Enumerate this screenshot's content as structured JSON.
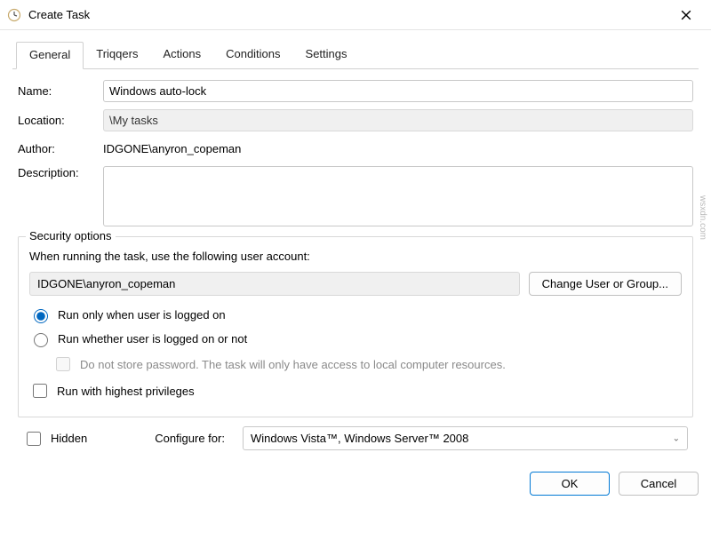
{
  "titlebar": {
    "title": "Create Task"
  },
  "tabs": {
    "general": "General",
    "triggers": "Triqqers",
    "actions": "Actions",
    "conditions": "Conditions",
    "settings": "Settings"
  },
  "general": {
    "name_label": "Name:",
    "name_value": "Windows auto-lock",
    "location_label": "Location:",
    "location_value": "\\My tasks",
    "author_label": "Author:",
    "author_value": "IDGONE\\anyron_copeman",
    "description_label": "Description:",
    "description_value": ""
  },
  "security": {
    "legend": "Security options",
    "instruction": "When running the task, use the following user account:",
    "account": "IDGONE\\anyron_copeman",
    "change_button": "Change User or Group...",
    "radio_logged_on": "Run only when user is logged on",
    "radio_whether": "Run whether user is logged on or not",
    "no_store_pw": "Do not store password.  The task will only have access to local computer resources.",
    "highest_priv": "Run with highest privileges"
  },
  "bottom": {
    "hidden_label": "Hidden",
    "configure_label": "Configure for:",
    "configure_value": "Windows Vista™, Windows Server™ 2008"
  },
  "buttons": {
    "ok": "OK",
    "cancel": "Cancel"
  },
  "watermark": "wsxdn.com"
}
